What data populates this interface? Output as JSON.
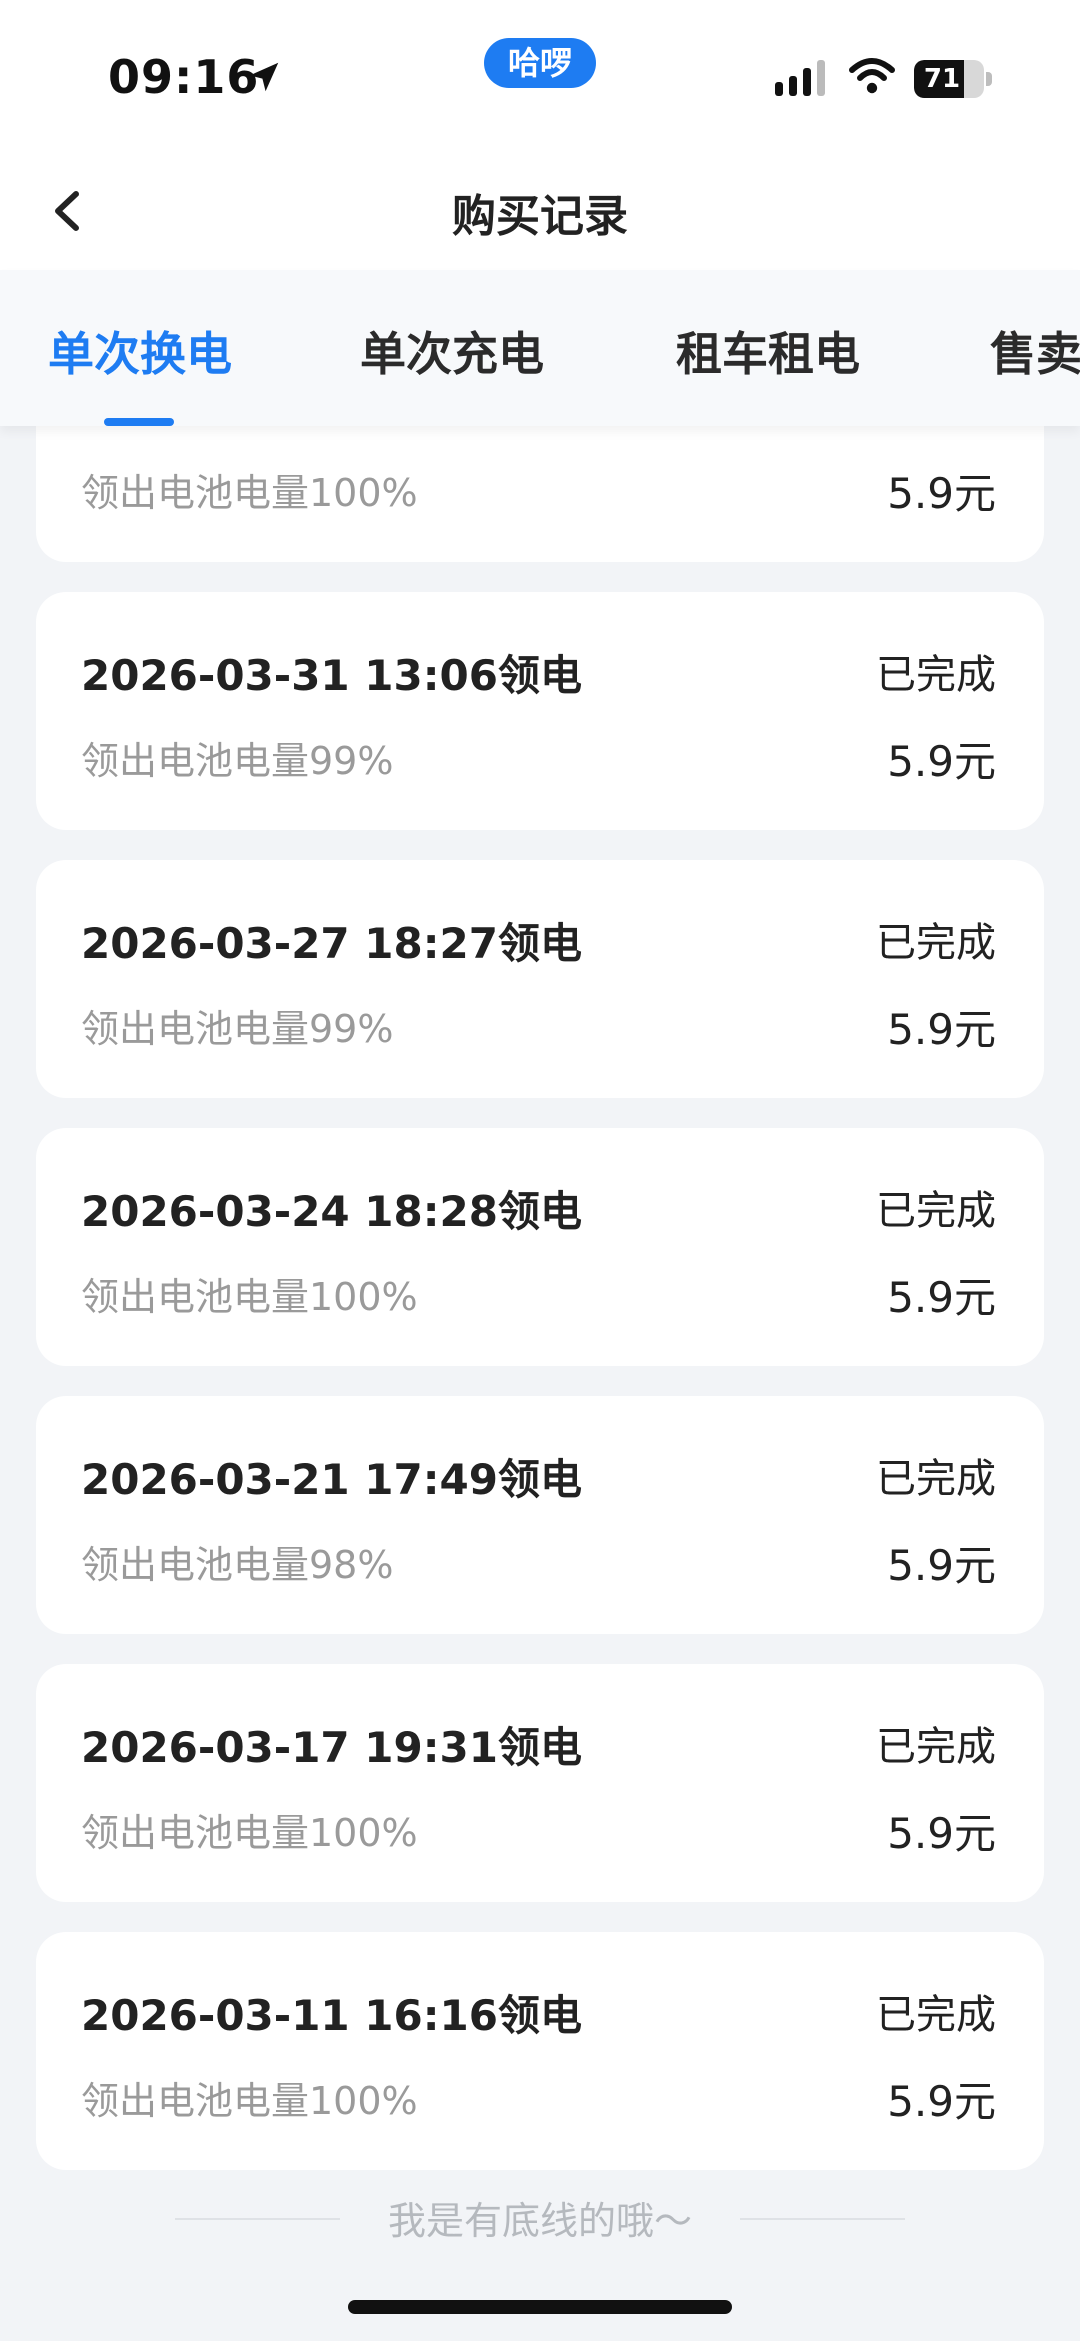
{
  "status_bar": {
    "time": "09:16",
    "app_badge": "哈啰",
    "battery_level": "71",
    "battery_fraction": 0.71,
    "icons": [
      "location-arrow-icon",
      "signal-icon",
      "wifi-icon",
      "battery-icon"
    ]
  },
  "header": {
    "title": "购买记录",
    "back_icon": "chevron-left-icon"
  },
  "tabs": [
    {
      "label": "单次换电",
      "active": true
    },
    {
      "label": "单次充电",
      "active": false
    },
    {
      "label": "租车租电",
      "active": false
    },
    {
      "label": "售卖",
      "active": false
    }
  ],
  "records": [
    {
      "title": "",
      "status": "",
      "sub": "领出电池电量100%",
      "price": "5.9元"
    },
    {
      "title": "2026-03-31 13:06领电",
      "status": "已完成",
      "sub": "领出电池电量99%",
      "price": "5.9元"
    },
    {
      "title": "2026-03-27 18:27领电",
      "status": "已完成",
      "sub": "领出电池电量99%",
      "price": "5.9元"
    },
    {
      "title": "2026-03-24 18:28领电",
      "status": "已完成",
      "sub": "领出电池电量100%",
      "price": "5.9元"
    },
    {
      "title": "2026-03-21 17:49领电",
      "status": "已完成",
      "sub": "领出电池电量98%",
      "price": "5.9元"
    },
    {
      "title": "2026-03-17 19:31领电",
      "status": "已完成",
      "sub": "领出电池电量100%",
      "price": "5.9元"
    },
    {
      "title": "2026-03-11 16:16领电",
      "status": "已完成",
      "sub": "领出电池电量100%",
      "price": "5.9元"
    }
  ],
  "footer": {
    "text": "我是有底线的哦～"
  },
  "colors": {
    "accent": "#1e7cf2",
    "page_bg": "#f2f4f7",
    "card_bg": "#ffffff",
    "muted_text": "#9a9a9a"
  }
}
